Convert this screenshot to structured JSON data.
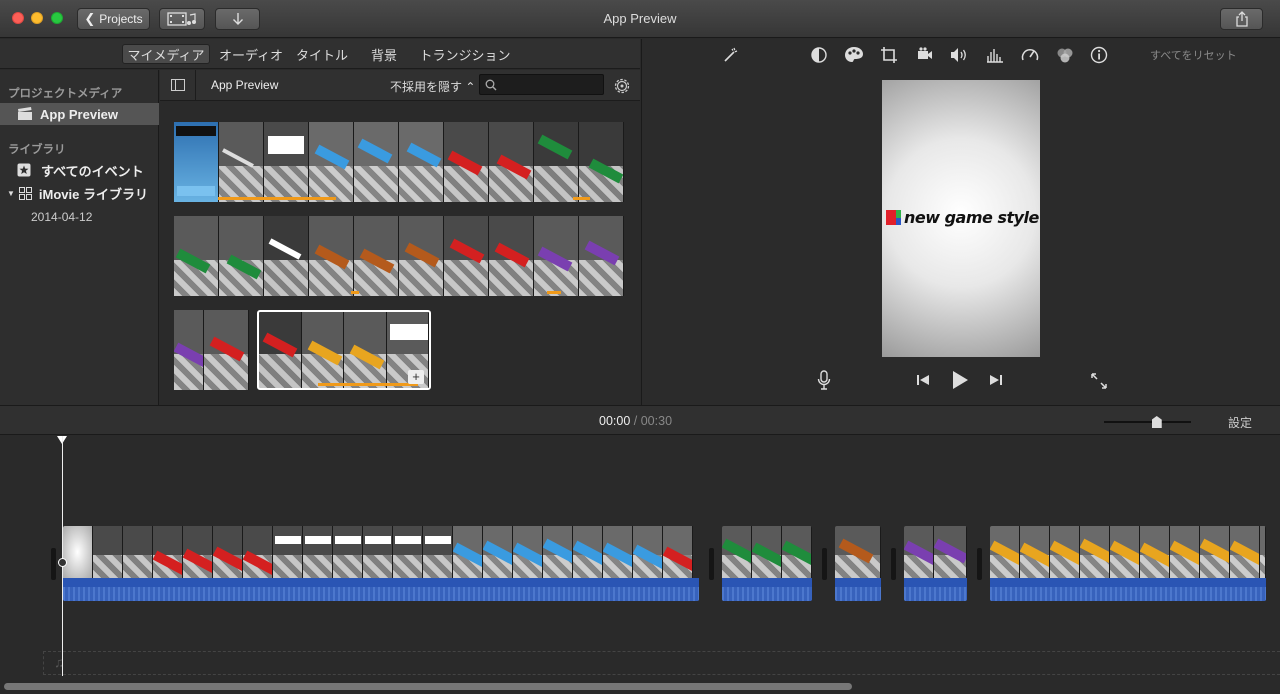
{
  "window": {
    "title": "App Preview"
  },
  "toolbar": {
    "projects_label": "Projects",
    "media_icon": "film-music-icon",
    "import_icon": "import-arrow-icon",
    "share_icon": "share-icon"
  },
  "library_tabs": [
    {
      "label": "マイメディア",
      "active": true
    },
    {
      "label": "オーディオ",
      "active": false
    },
    {
      "label": "タイトル",
      "active": false
    },
    {
      "label": "背景",
      "active": false
    },
    {
      "label": "トランジション",
      "active": false
    }
  ],
  "sidebar": {
    "project_media_header": "プロジェクトメディア",
    "project_item": "App Preview",
    "libraries_header": "ライブラリ",
    "all_events": "すべてのイベント",
    "imovie_library": "iMovie ライブラリ",
    "event_date": "2014-04-12"
  },
  "browser": {
    "title": "App Preview",
    "hide_rejected": "不採用を隠す ⌃",
    "search_value": "",
    "search_placeholder": ""
  },
  "viewer": {
    "reset_all": "すべてをリセット",
    "preview_text": "new game style"
  },
  "timeline": {
    "current_time": "00:00",
    "separator": "/",
    "duration": "00:30",
    "settings": "設定",
    "zoom_level": 0.62
  },
  "colors": {
    "accent_orange": "#f09a1a",
    "audio_blue": "#2a55b4",
    "logo_red": "#e0202a",
    "logo_green": "#2fb14a",
    "logo_blue": "#2a56c8"
  }
}
